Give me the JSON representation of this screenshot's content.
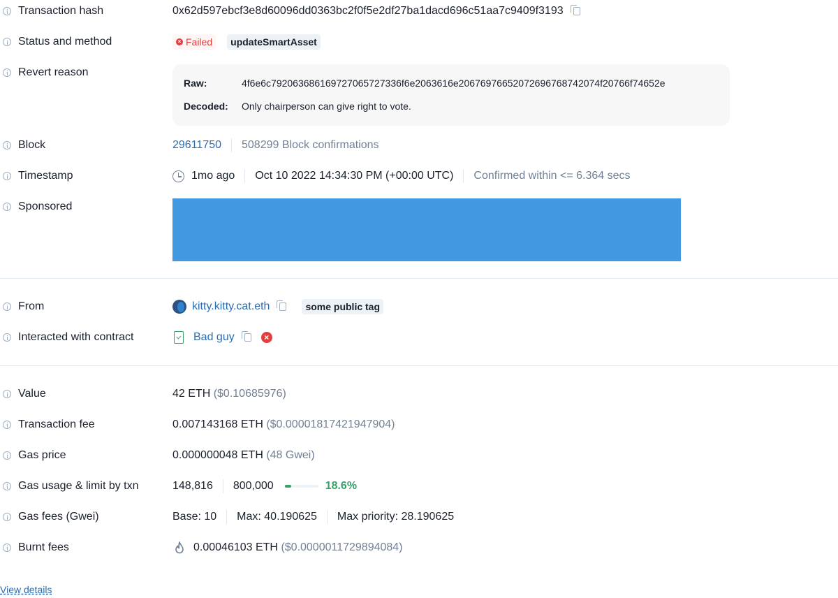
{
  "fields": {
    "tx_hash": {
      "label": "Transaction hash",
      "value": "0x62d597ebcf3e8d60096dd0363bc2f0f5e2df27ba1dacd696c51aa7c9409f3193"
    },
    "status": {
      "label": "Status and method",
      "status": "Failed",
      "method": "updateSmartAsset"
    },
    "revert": {
      "label": "Revert reason",
      "raw_key": "Raw:",
      "raw_value": "4f6e6c792063686169727065727336f6e2063616e20676976652072696768742074f20766f74652e",
      "decoded_key": "Decoded:",
      "decoded_value": "Only chairperson can give right to vote."
    },
    "block": {
      "label": "Block",
      "number": "29611750",
      "confirmations": "508299 Block confirmations"
    },
    "timestamp": {
      "label": "Timestamp",
      "relative": "1mo ago",
      "absolute": "Oct 10 2022 14:34:30 PM (+00:00 UTC)",
      "confirmed": "Confirmed within <= 6.364 secs"
    },
    "sponsored": {
      "label": "Sponsored"
    },
    "from": {
      "label": "From",
      "address": "kitty.kitty.cat.eth",
      "tag": "some public tag"
    },
    "contract": {
      "label": "Interacted with contract",
      "name": "Bad guy"
    },
    "value": {
      "label": "Value",
      "amount": "42 ETH",
      "usd": "($0.10685976)"
    },
    "fee": {
      "label": "Transaction fee",
      "amount": "0.007143168 ETH",
      "usd": "($0.00001817421947904)"
    },
    "gas_price": {
      "label": "Gas price",
      "amount": "0.000000048 ETH",
      "gwei": "(48 Gwei)"
    },
    "gas_usage": {
      "label": "Gas usage & limit by txn",
      "used": "148,816",
      "limit": "800,000",
      "percent": "18.6%",
      "fraction": 0.186
    },
    "gas_fees": {
      "label": "Gas fees (Gwei)",
      "base": "Base: 10",
      "max": "Max: 40.190625",
      "priority": "Max priority: 28.190625"
    },
    "burnt": {
      "label": "Burnt fees",
      "amount": "0.00046103 ETH",
      "usd": "($0.0000011729894084)"
    }
  },
  "colors": {
    "ad_banner": "#4299e1",
    "failed": "#e53e3e",
    "success": "#38a169",
    "link": "#2b6cb0"
  },
  "view_details": "View details"
}
